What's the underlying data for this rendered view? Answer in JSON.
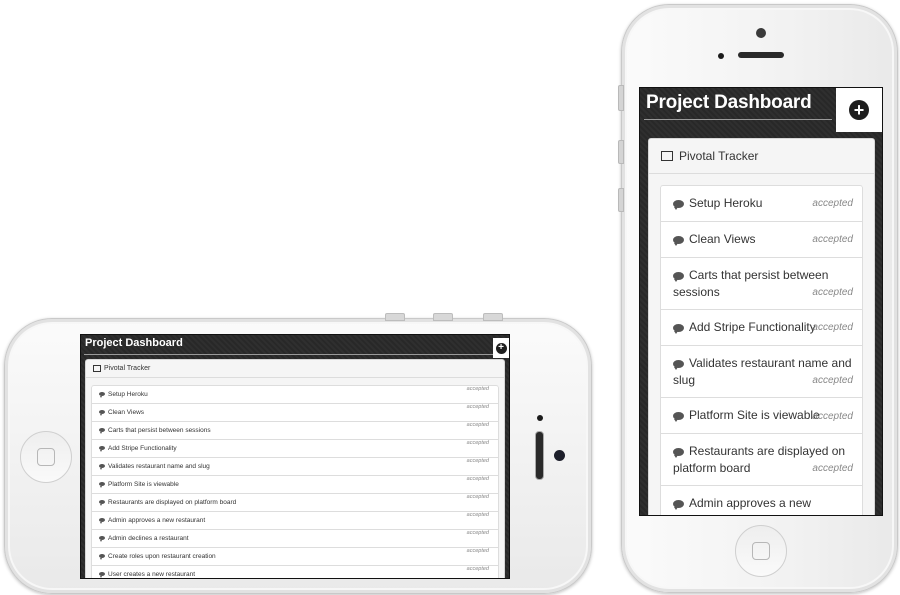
{
  "app": {
    "title": "Project Dashboard",
    "add_button_icon": "plus-circle-icon",
    "panel": {
      "icon": "list-icon",
      "title": "Pivotal Tracker"
    }
  },
  "stories": [
    {
      "name": "Setup Heroku",
      "state": "accepted"
    },
    {
      "name": "Clean Views",
      "state": "accepted"
    },
    {
      "name": "Carts that persist between sessions",
      "state": "accepted"
    },
    {
      "name": "Add Stripe Functionality",
      "state": "accepted"
    },
    {
      "name": "Validates restaurant name and slug",
      "state": "accepted"
    },
    {
      "name": "Platform Site is viewable",
      "state": "accepted"
    },
    {
      "name": "Restaurants are displayed on platform board",
      "state": "accepted"
    },
    {
      "name": "Admin approves a new restaurant",
      "state": "accepted"
    },
    {
      "name": "Admin declines a restaurant",
      "state": "accepted"
    },
    {
      "name": "Create roles upon restaurant creation",
      "state": "accepted"
    },
    {
      "name": "User creates a new restaurant",
      "state": "accepted"
    }
  ],
  "icons": {
    "story": "comment-icon",
    "home_button": "home-button-icon"
  },
  "colors": {
    "app_background": "#2c2c2c",
    "header_text": "#ffffff",
    "panel_background": "#f5f5f5",
    "state_text": "#888888"
  }
}
